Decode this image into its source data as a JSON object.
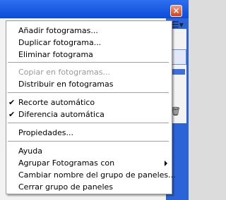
{
  "window": {
    "close_glyph": "×",
    "panel_menu_glyph": "☰▾",
    "trash_glyph": "🗑"
  },
  "menu": {
    "items": [
      {
        "label": "Añadir fotogramas...",
        "enabled": true,
        "checked": false
      },
      {
        "label": "Duplicar fotograma...",
        "enabled": true,
        "checked": false
      },
      {
        "label": "Eliminar fotograma",
        "enabled": true,
        "checked": false
      },
      {
        "label": "Copiar en fotogramas...",
        "enabled": false,
        "checked": false
      },
      {
        "label": "Distribuir en fotogramas",
        "enabled": true,
        "checked": false
      },
      {
        "label": "Recorte automático",
        "enabled": true,
        "checked": true
      },
      {
        "label": "Diferencia automática",
        "enabled": true,
        "checked": true
      },
      {
        "label": "Propiedades...",
        "enabled": true,
        "checked": false
      },
      {
        "label": "Ayuda",
        "enabled": true,
        "checked": false
      },
      {
        "label": "Agrupar Fotogramas con",
        "enabled": true,
        "checked": false,
        "submenu": true
      },
      {
        "label": "Cambiar nombre del grupo de paneles...",
        "enabled": true,
        "checked": false
      },
      {
        "label": "Cerrar grupo de paneles",
        "enabled": true,
        "checked": false
      }
    ],
    "check_glyph": "✔"
  }
}
